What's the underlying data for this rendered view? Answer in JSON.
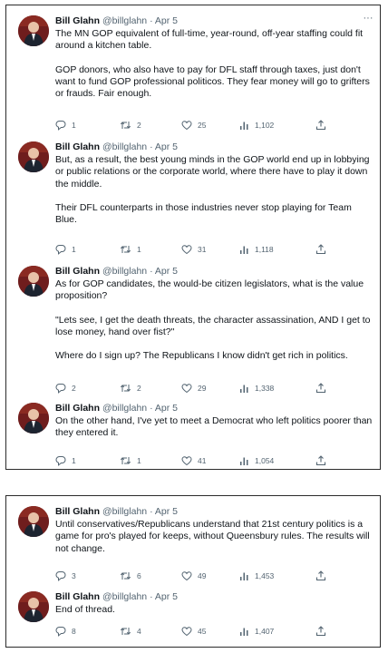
{
  "threads": [
    {
      "tweets": [
        {
          "author": "Bill Glahn",
          "handle": "@billglahn",
          "date": "Apr 5",
          "paragraphs": [
            "The MN GOP equivalent of full-time, year-round, off-year staffing could fit around a kitchen table.",
            "GOP donors, who also have to pay for DFL staff through taxes, just don't want to fund GOP professional politicos. They fear money will go to grifters or frauds. Fair enough."
          ],
          "replies": "1",
          "retweets": "2",
          "likes": "25",
          "views": "1,102"
        },
        {
          "author": "Bill Glahn",
          "handle": "@billglahn",
          "date": "Apr 5",
          "paragraphs": [
            "But, as a result, the best young minds in the GOP world end up in lobbying or public relations or the corporate world, where there have to play it down the middle.",
            "Their DFL counterparts in those industries never stop playing for Team Blue."
          ],
          "replies": "1",
          "retweets": "1",
          "likes": "31",
          "views": "1,118"
        },
        {
          "author": "Bill Glahn",
          "handle": "@billglahn",
          "date": "Apr 5",
          "paragraphs": [
            "As for GOP candidates, the would-be citizen legislators, what is the value proposition?",
            "\"Lets see, I get the death threats, the character assassination, AND I get to lose money, hand over fist?\"",
            "Where do I sign up? The Republicans I know didn't get rich in politics."
          ],
          "replies": "2",
          "retweets": "2",
          "likes": "29",
          "views": "1,338"
        },
        {
          "author": "Bill Glahn",
          "handle": "@billglahn",
          "date": "Apr 5",
          "paragraphs": [
            "On the other hand, I've yet to meet a Democrat who left politics poorer than they entered it."
          ],
          "replies": "1",
          "retweets": "1",
          "likes": "41",
          "views": "1,054"
        }
      ]
    },
    {
      "tweets": [
        {
          "author": "Bill Glahn",
          "handle": "@billglahn",
          "date": "Apr 5",
          "paragraphs": [
            "Until conservatives/Republicans understand that 21st century politics is a game for pro's played for keeps, without Queensbury rules. The results will not change."
          ],
          "replies": "3",
          "retweets": "6",
          "likes": "49",
          "views": "1,453"
        },
        {
          "author": "Bill Glahn",
          "handle": "@billglahn",
          "date": "Apr 5",
          "paragraphs": [
            "End of thread."
          ],
          "replies": "8",
          "retweets": "4",
          "likes": "45",
          "views": "1,407"
        }
      ]
    }
  ],
  "icons": {
    "reply": "reply-icon",
    "retweet": "retweet-icon",
    "like": "heart-icon",
    "views": "views-icon",
    "share": "share-icon",
    "more": "more-icon",
    "avatar": "avatar"
  },
  "colors": {
    "text": "#0f1419",
    "muted": "#536471",
    "frame_border": "#2b2b2b",
    "avatar_bg": "#6f1d1d"
  },
  "separator": "·",
  "more_glyph": "···"
}
